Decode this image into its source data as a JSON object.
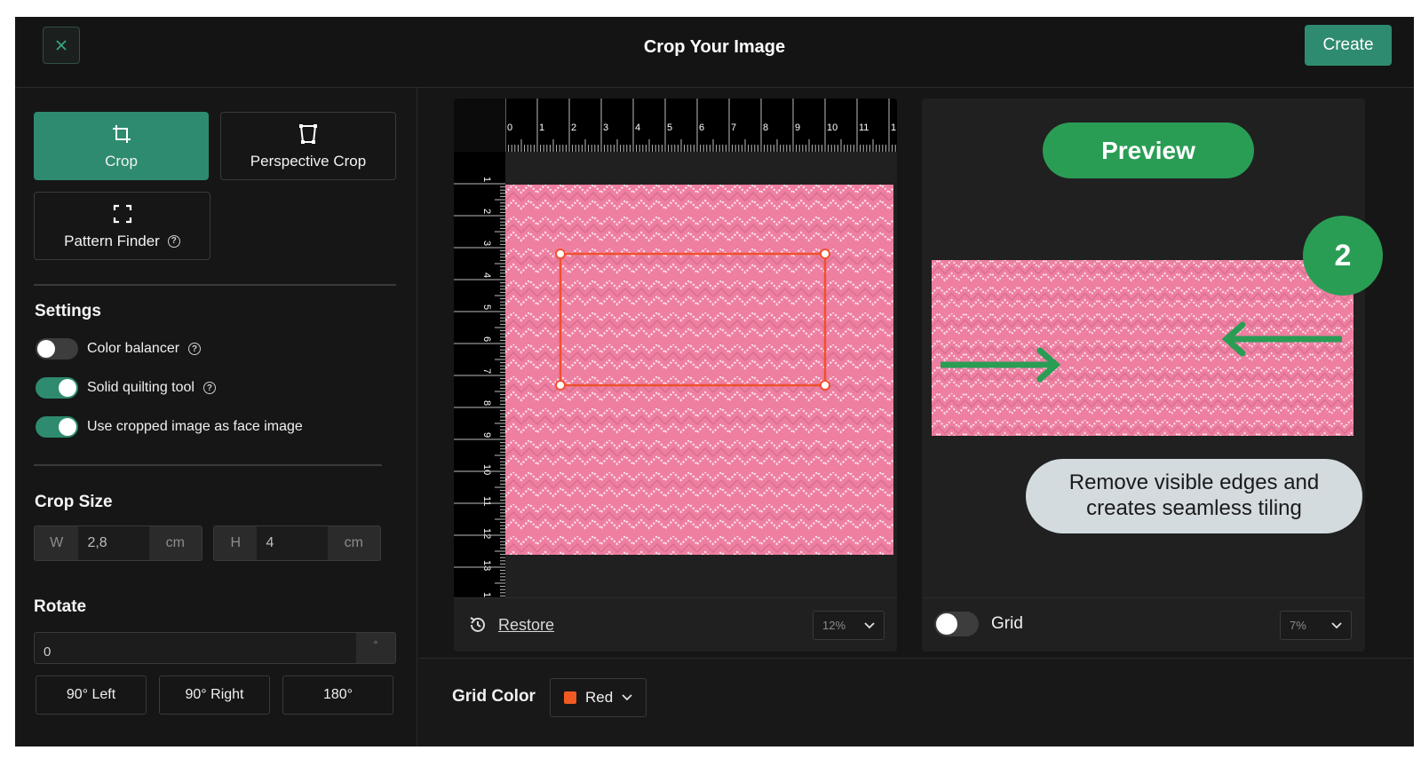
{
  "header": {
    "title": "Crop Your Image",
    "create_label": "Create"
  },
  "tools": {
    "crop_label": "Crop",
    "perspective_label": "Perspective Crop",
    "pattern_finder_label": "Pattern Finder",
    "help_glyph": "?"
  },
  "settings": {
    "title": "Settings",
    "toggles": [
      {
        "label": "Color balancer",
        "on": false
      },
      {
        "label": "Solid quilting tool",
        "on": true
      },
      {
        "label": "Use cropped image as face image",
        "on": true
      }
    ]
  },
  "crop_size": {
    "title": "Crop Size",
    "w_label": "W",
    "w_value": "2,8",
    "w_unit": "cm",
    "h_label": "H",
    "h_value": "4",
    "h_unit": "cm"
  },
  "rotate": {
    "title": "Rotate",
    "value": "0",
    "unit": "°",
    "left_label": "90° Left",
    "right_label": "90° Right",
    "flip_label": "180°"
  },
  "canvas": {
    "ruler_top": [
      "0",
      "1",
      "2",
      "3",
      "4",
      "5",
      "6",
      "7",
      "8",
      "9",
      "10",
      "11",
      "1"
    ],
    "ruler_left": [
      "1",
      "2",
      "3",
      "4",
      "5",
      "6",
      "7",
      "8",
      "9",
      "10",
      "11",
      "12",
      "13",
      "14"
    ],
    "restore_label": "Restore",
    "zoom": "12%"
  },
  "preview": {
    "badge": "Preview",
    "grid_label": "Grid",
    "grid_on": false,
    "zoom": "7%"
  },
  "annotations": {
    "step": "2",
    "callout": "Remove visible edges and creates seamless tiling"
  },
  "grid_color": {
    "label": "Grid Color",
    "value": "Red",
    "swatch": "#f15a22"
  },
  "colors": {
    "accent": "#2e8b6f",
    "badge_green": "#2a9d55",
    "fabric": "#ee7fa1",
    "crop_box": "#f0502d"
  }
}
